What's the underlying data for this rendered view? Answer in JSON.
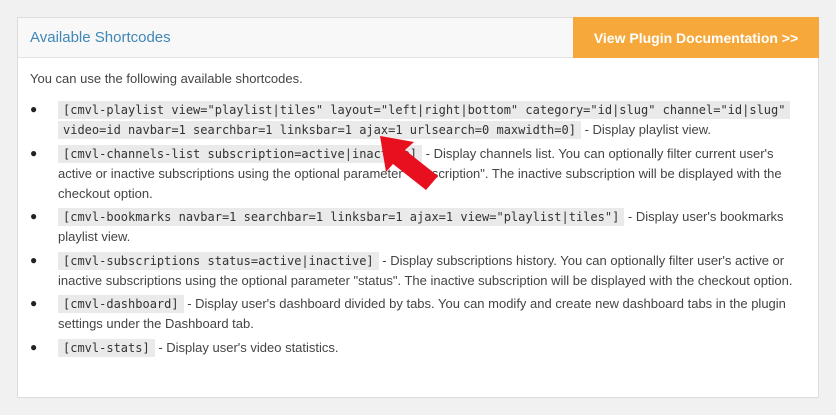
{
  "panel": {
    "title": "Available Shortcodes",
    "doc_button": "View Plugin Documentation >>",
    "intro": "You can use the following available shortcodes."
  },
  "shortcodes": [
    {
      "code": "[cmvl-playlist view=\"playlist|tiles\" layout=\"left|right|bottom\" category=\"id|slug\" channel=\"id|slug\" video=id navbar=1 searchbar=1 linksbar=1 ajax=1 urlsearch=0 maxwidth=0]",
      "description": " - Display playlist view."
    },
    {
      "code": "[cmvl-channels-list subscription=active|inactive]",
      "description": " - Display channels list. You can optionally filter current user's active or inactive subscriptions using the optional parameter \"subscription\". The inactive subscription will be displayed with the checkout option."
    },
    {
      "code": "[cmvl-bookmarks navbar=1 searchbar=1 linksbar=1 ajax=1 view=\"playlist|tiles\"]",
      "description": " - Display user's bookmarks playlist view."
    },
    {
      "code": "[cmvl-subscriptions status=active|inactive]",
      "description": " - Display subscriptions history. You can optionally filter user's active or inactive subscriptions using the optional parameter \"status\". The inactive subscription will be displayed with the checkout option."
    },
    {
      "code": "[cmvl-dashboard]",
      "description": " - Display user's dashboard divided by tabs. You can modify and create new dashboard tabs in the plugin settings under the Dashboard tab."
    },
    {
      "code": "[cmvl-stats]",
      "description": " - Display user's video statistics."
    }
  ],
  "colors": {
    "title": "#3f87b7",
    "doc_button_bg": "#f6a83b",
    "arrow": "#e8101e"
  }
}
